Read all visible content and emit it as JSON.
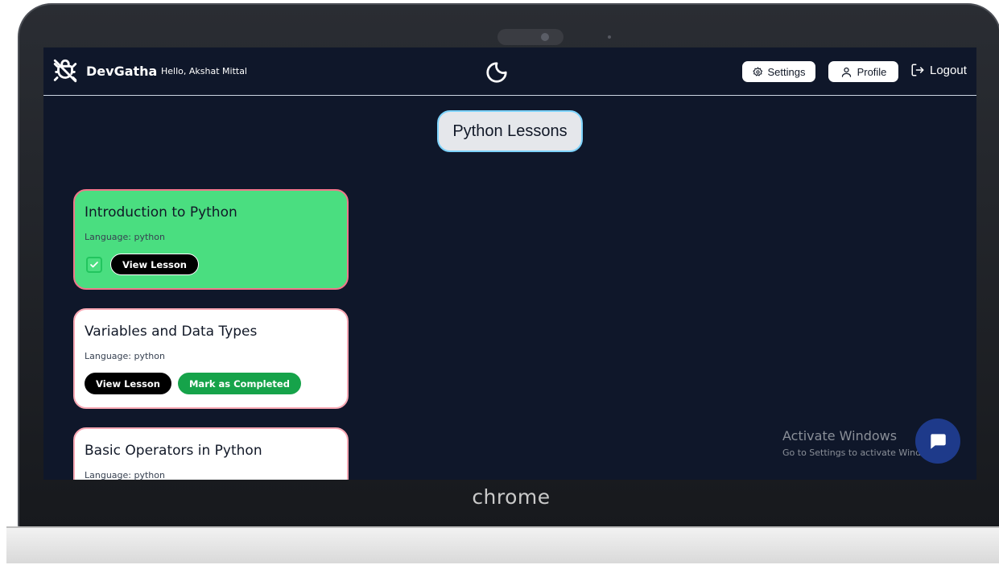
{
  "app": {
    "name": "DevGatha",
    "greeting": "Hello, Akshat Mittal",
    "logo_icon": "bug-off-icon"
  },
  "nav": {
    "theme_toggle_icon": "moon-icon",
    "settings_label": "Settings",
    "settings_icon": "gear-icon",
    "profile_label": "Profile",
    "profile_icon": "user-icon",
    "logout_label": "Logout",
    "logout_icon": "logout-icon"
  },
  "page": {
    "title": "Python Lessons"
  },
  "lessons": [
    {
      "title": "Introduction to Python",
      "language": "Language: python",
      "completed": true,
      "view_label": "View Lesson"
    },
    {
      "title": "Variables and Data Types",
      "language": "Language: python",
      "completed": false,
      "view_label": "View Lesson",
      "mark_label": "Mark as Completed"
    },
    {
      "title": "Basic Operators in Python",
      "language": "Language: python",
      "completed": false
    }
  ],
  "watermark": {
    "title": "Activate Windows",
    "subtitle": "Go to Settings to activate Windows."
  },
  "chat": {
    "icon": "chat-bubble-icon"
  },
  "device": {
    "brand": "chrome"
  },
  "colors": {
    "background": "#0f172a",
    "completed_card": "#4ade80",
    "card_border": "#f9a8b4",
    "mark_button": "#16a34a",
    "title_border": "#7dd3fc",
    "chat_button": "#1e3a8a"
  }
}
